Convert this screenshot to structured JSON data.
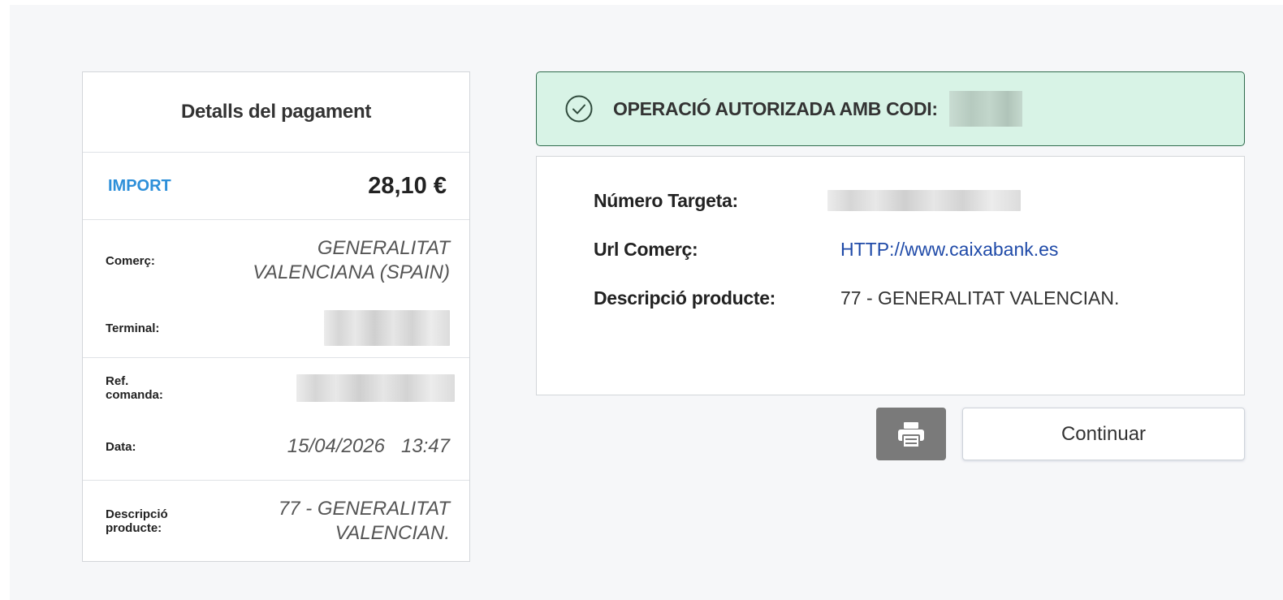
{
  "payment_details": {
    "title": "Detalls del pagament",
    "amount_label": "IMPORT",
    "amount_value": "28,10 €",
    "merchant_label": "Comerç:",
    "merchant_value_line1": "GENERALITAT",
    "merchant_value_line2": "VALENCIANA (SPAIN)",
    "terminal_label": "Terminal:",
    "order_ref_label_line1": "Ref.",
    "order_ref_label_line2": "comanda:",
    "date_label": "Data:",
    "date_value": "15/04/2026",
    "time_value": "13:47",
    "description_label_line1": "Descripció",
    "description_label_line2": "producte:",
    "description_value_line1": "77 - GENERALITAT",
    "description_value_line2": "VALENCIAN."
  },
  "banner": {
    "text": "OPERACIÓ AUTORIZADA AMB CODI:",
    "icon": "check-circle-icon",
    "color": "#d8f3e6"
  },
  "info_panel": {
    "card_number_label": "Número Targeta:",
    "merchant_url_label": "Url Comerç:",
    "merchant_url_value": "HTTP://www.caixabank.es",
    "product_description_label": "Descripció producte:",
    "product_description_value": "77 - GENERALITAT VALENCIAN."
  },
  "actions": {
    "print_icon": "printer-icon",
    "continue_label": "Continuar"
  },
  "colors": {
    "accent_blue": "#2d8fd9",
    "link_blue": "#1f4aa8",
    "success_border": "#2f6b4d"
  }
}
